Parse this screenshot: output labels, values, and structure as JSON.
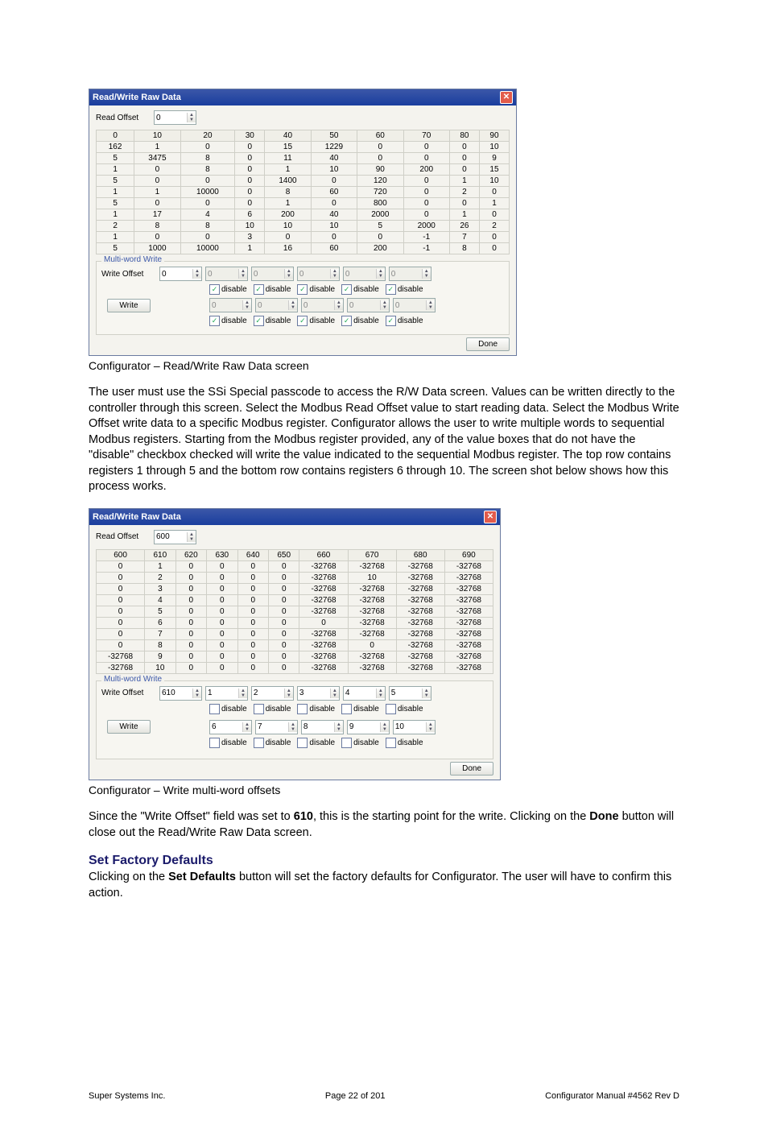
{
  "dialog_title": "Read/Write Raw Data",
  "read_offset_label": "Read Offset",
  "multi_word_title": "Multi-word Write",
  "write_offset_label": "Write Offset",
  "write_btn": "Write",
  "disable_label": "disable",
  "done_btn": "Done",
  "caption1": "Configurator – Read/Write Raw Data screen",
  "para1": "The user must use the SSi Special passcode to access the R/W Data screen.  Values can be written directly to the controller through this screen.  Select the Modbus Read Offset value to start reading data.  Select the Modbus Write Offset write data to a specific Modbus register.  Configurator allows the user to write multiple words to sequential Modbus registers.   Starting from the Modbus register provided, any of the value boxes that do not have the \"disable\" checkbox checked will write the value indicated to the sequential Modbus register.  The top row contains registers 1 through 5 and the bottom row contains registers 6 through 10.  The screen shot below shows how this process works.",
  "caption2": "Configurator – Write multi-word offsets",
  "para2_a": "Since the \"Write Offset\" field was set to ",
  "para2_bold": "610",
  "para2_b": ", this is the starting point for the write.  Clicking on the ",
  "para2_bold2": "Done",
  "para2_c": " button will close out the Read/Write Raw Data screen.",
  "heading2": "Set Factory Defaults",
  "para3_a": "Clicking on the ",
  "para3_bold": "Set Defaults",
  "para3_b": " button will set the factory defaults for Configurator.  The user will have to confirm this action.",
  "footer_left": "Super Systems Inc.",
  "footer_center": "Page 22 of 201",
  "footer_right": "Configurator Manual #4562 Rev D",
  "shot1": {
    "read_offset": "0",
    "headers": [
      "0",
      "10",
      "20",
      "30",
      "40",
      "50",
      "60",
      "70",
      "80",
      "90"
    ],
    "rows": [
      [
        "162",
        "1",
        "0",
        "0",
        "15",
        "1229",
        "0",
        "0",
        "0",
        "10"
      ],
      [
        "5",
        "3475",
        "8",
        "0",
        "11",
        "40",
        "0",
        "0",
        "0",
        "9"
      ],
      [
        "1",
        "0",
        "8",
        "0",
        "1",
        "10",
        "90",
        "200",
        "0",
        "15"
      ],
      [
        "5",
        "0",
        "0",
        "0",
        "1400",
        "0",
        "120",
        "0",
        "1",
        "10"
      ],
      [
        "1",
        "1",
        "10000",
        "0",
        "8",
        "60",
        "720",
        "0",
        "2",
        "0"
      ],
      [
        "5",
        "0",
        "0",
        "0",
        "1",
        "0",
        "800",
        "0",
        "0",
        "1"
      ],
      [
        "1",
        "17",
        "4",
        "6",
        "200",
        "40",
        "2000",
        "0",
        "1",
        "0"
      ],
      [
        "2",
        "8",
        "8",
        "10",
        "10",
        "10",
        "5",
        "2000",
        "26",
        "2"
      ],
      [
        "1",
        "0",
        "0",
        "3",
        "0",
        "0",
        "0",
        "-1",
        "7",
        "0"
      ],
      [
        "5",
        "1000",
        "10000",
        "1",
        "16",
        "60",
        "200",
        "-1",
        "8",
        "0"
      ]
    ],
    "write_offset": "0",
    "row1_vals": [
      "0",
      "0",
      "0",
      "0",
      "0"
    ],
    "row1_checked": [
      true,
      true,
      true,
      true,
      true
    ],
    "row2_vals": [
      "0",
      "0",
      "0",
      "0",
      "0"
    ],
    "row2_checked": [
      true,
      true,
      true,
      true,
      true
    ]
  },
  "shot2": {
    "read_offset": "600",
    "headers": [
      "600",
      "610",
      "620",
      "630",
      "640",
      "650",
      "660",
      "670",
      "680",
      "690"
    ],
    "rows": [
      [
        "0",
        "1",
        "0",
        "0",
        "0",
        "0",
        "-32768",
        "-32768",
        "-32768",
        "-32768"
      ],
      [
        "0",
        "2",
        "0",
        "0",
        "0",
        "0",
        "-32768",
        "10",
        "-32768",
        "-32768"
      ],
      [
        "0",
        "3",
        "0",
        "0",
        "0",
        "0",
        "-32768",
        "-32768",
        "-32768",
        "-32768"
      ],
      [
        "0",
        "4",
        "0",
        "0",
        "0",
        "0",
        "-32768",
        "-32768",
        "-32768",
        "-32768"
      ],
      [
        "0",
        "5",
        "0",
        "0",
        "0",
        "0",
        "-32768",
        "-32768",
        "-32768",
        "-32768"
      ],
      [
        "0",
        "6",
        "0",
        "0",
        "0",
        "0",
        "0",
        "-32768",
        "-32768",
        "-32768"
      ],
      [
        "0",
        "7",
        "0",
        "0",
        "0",
        "0",
        "-32768",
        "-32768",
        "-32768",
        "-32768"
      ],
      [
        "0",
        "8",
        "0",
        "0",
        "0",
        "0",
        "-32768",
        "0",
        "-32768",
        "-32768"
      ],
      [
        "-32768",
        "9",
        "0",
        "0",
        "0",
        "0",
        "-32768",
        "-32768",
        "-32768",
        "-32768"
      ],
      [
        "-32768",
        "10",
        "0",
        "0",
        "0",
        "0",
        "-32768",
        "-32768",
        "-32768",
        "-32768"
      ]
    ],
    "write_offset": "610",
    "row1_vals": [
      "1",
      "2",
      "3",
      "4",
      "5"
    ],
    "row1_checked": [
      false,
      false,
      false,
      false,
      false
    ],
    "row2_vals": [
      "6",
      "7",
      "8",
      "9",
      "10"
    ],
    "row2_checked": [
      false,
      false,
      false,
      false,
      false
    ]
  }
}
